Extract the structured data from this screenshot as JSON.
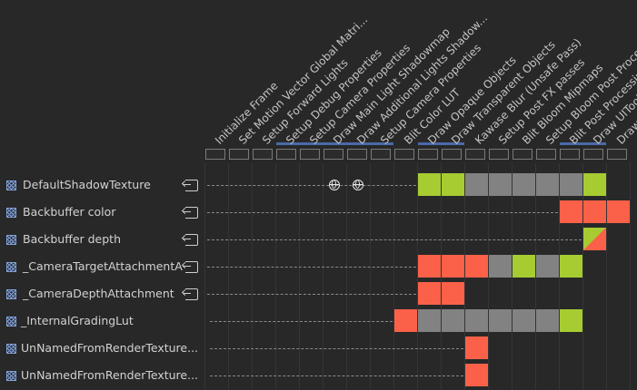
{
  "passes": [
    "Initialize Frame",
    "Set Motion Vector Global Matri...",
    "Setup Forward Lights",
    "Setup Debug Properties",
    "Setup Camera Properties",
    "Draw Main Light Shadowmap",
    "Draw Additional Lights Shadow...",
    "Setup Camera Properties",
    "Blit Color LUT",
    "Draw Opaque Objects",
    "Draw Transparent Objects",
    "Kawase Blur (Unsafe Pass)",
    "Setup Post FX passes",
    "Blit Bloom Mipmaps",
    "Setup Bloom Post Processing",
    "Blit Post Processing",
    "Draw UIToolkit",
    "Draw IMGUI"
  ],
  "merged_pass_groups": [
    {
      "from": 3,
      "to": 7
    },
    {
      "from": 9,
      "to": 10
    },
    {
      "from": 15,
      "to": 16
    }
  ],
  "resources": [
    {
      "name": "DefaultShadowTexture",
      "imported": true,
      "accesses": [
        {
          "pass": 9,
          "state": "green"
        },
        {
          "pass": 10,
          "state": "green"
        },
        {
          "pass": 11,
          "state": "grey"
        },
        {
          "pass": 12,
          "state": "grey"
        },
        {
          "pass": 13,
          "state": "grey"
        },
        {
          "pass": 14,
          "state": "grey"
        },
        {
          "pass": 15,
          "state": "grey"
        },
        {
          "pass": 16,
          "state": "green"
        }
      ],
      "globals": [
        5,
        6
      ]
    },
    {
      "name": "Backbuffer color",
      "imported": true,
      "accesses": [
        {
          "pass": 15,
          "state": "red"
        },
        {
          "pass": 16,
          "state": "red"
        },
        {
          "pass": 17,
          "state": "red"
        }
      ],
      "globals": []
    },
    {
      "name": "Backbuffer depth",
      "imported": true,
      "accesses": [
        {
          "pass": 16,
          "state": "split"
        }
      ],
      "globals": []
    },
    {
      "name": "_CameraTargetAttachmentA",
      "imported": true,
      "accesses": [
        {
          "pass": 9,
          "state": "red"
        },
        {
          "pass": 10,
          "state": "red"
        },
        {
          "pass": 11,
          "state": "red"
        },
        {
          "pass": 12,
          "state": "grey"
        },
        {
          "pass": 13,
          "state": "green"
        },
        {
          "pass": 14,
          "state": "grey"
        },
        {
          "pass": 15,
          "state": "green"
        }
      ],
      "globals": []
    },
    {
      "name": "_CameraDepthAttachment",
      "imported": true,
      "accesses": [
        {
          "pass": 9,
          "state": "red"
        },
        {
          "pass": 10,
          "state": "red"
        }
      ],
      "globals": []
    },
    {
      "name": "_InternalGradingLut",
      "imported": false,
      "accesses": [
        {
          "pass": 8,
          "state": "red"
        },
        {
          "pass": 9,
          "state": "grey"
        },
        {
          "pass": 10,
          "state": "grey"
        },
        {
          "pass": 11,
          "state": "grey"
        },
        {
          "pass": 12,
          "state": "grey"
        },
        {
          "pass": 13,
          "state": "grey"
        },
        {
          "pass": 14,
          "state": "grey"
        },
        {
          "pass": 15,
          "state": "green"
        }
      ],
      "globals": []
    },
    {
      "name": "UnNamedFromRenderTexture...",
      "imported": false,
      "accesses": [
        {
          "pass": 11,
          "state": "red"
        }
      ],
      "globals": []
    },
    {
      "name": "UnNamedFromRenderTexture...",
      "imported": false,
      "accesses": [
        {
          "pass": 11,
          "state": "red"
        }
      ],
      "globals": []
    }
  ],
  "colors": {
    "background": "#282828",
    "read": "#a6cc32",
    "write": "#fa6148",
    "unused": "#828282",
    "merge_bar": "#4a6aa8",
    "resource_icon": "#7fa0d8"
  },
  "icons": {
    "resource": "texture-icon",
    "imported": "import-icon",
    "global": "globe-icon"
  }
}
